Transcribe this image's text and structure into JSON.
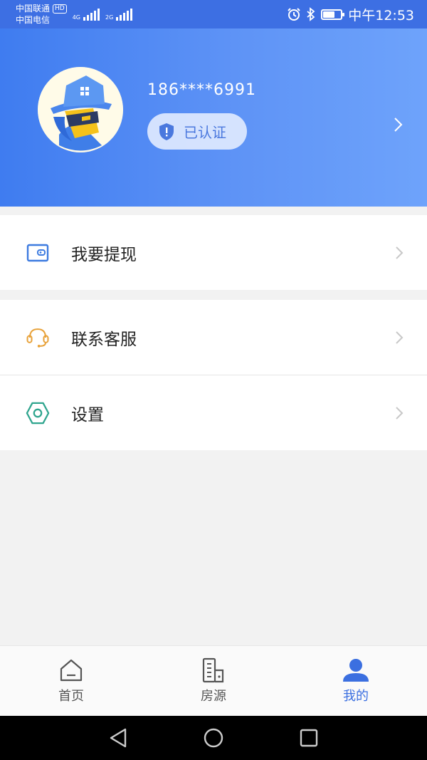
{
  "status_bar": {
    "carrier1": "中国联通",
    "hd": "HD",
    "carrier2": "中国电信",
    "net1": "4G",
    "net2": "2G",
    "time": "中午12:53"
  },
  "profile": {
    "phone": "186****6991",
    "verify_label": "已认证"
  },
  "menu": {
    "withdraw": "我要提现",
    "customer_service": "联系客服",
    "settings": "设置"
  },
  "tabs": [
    {
      "label": "首页",
      "icon": "home-icon"
    },
    {
      "label": "房源",
      "icon": "building-icon"
    },
    {
      "label": "我的",
      "icon": "user-icon"
    }
  ],
  "colors": {
    "accent": "#3b6fe0",
    "withdraw_icon": "#3d7be0",
    "service_icon": "#e8a23a",
    "settings_icon": "#2fa58e"
  }
}
